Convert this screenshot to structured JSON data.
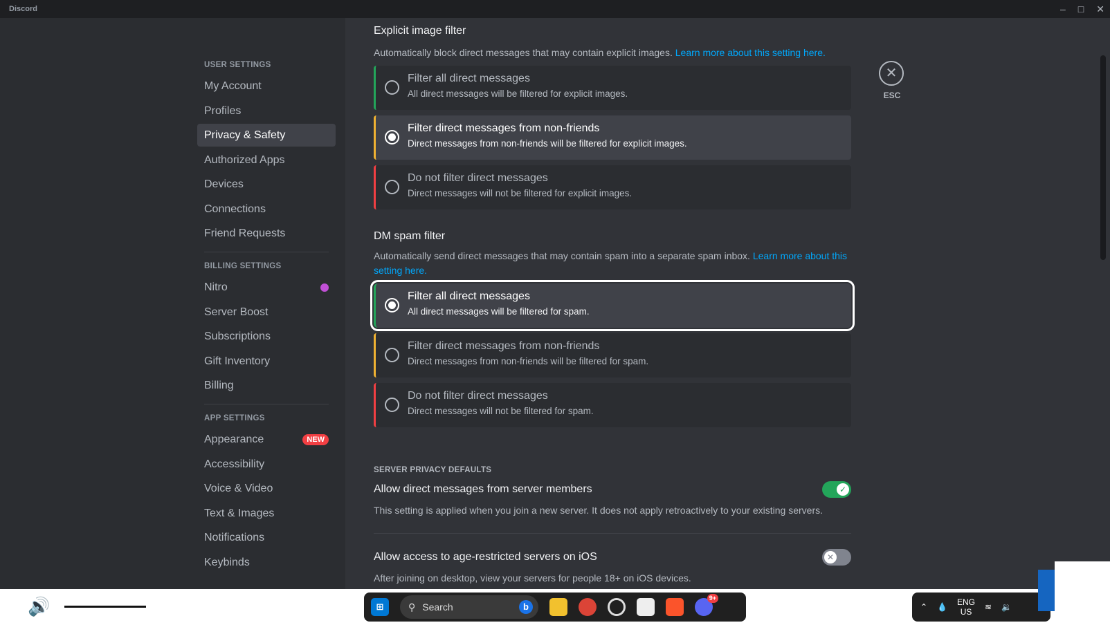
{
  "app": {
    "title": "Discord",
    "window_controls": [
      "minimize",
      "maximize",
      "close"
    ]
  },
  "sidebar": {
    "sections": [
      {
        "header": "USER SETTINGS",
        "items": [
          {
            "label": "My Account"
          },
          {
            "label": "Profiles"
          },
          {
            "label": "Privacy & Safety",
            "selected": true
          },
          {
            "label": "Authorized Apps"
          },
          {
            "label": "Devices"
          },
          {
            "label": "Connections"
          },
          {
            "label": "Friend Requests"
          }
        ]
      },
      {
        "header": "BILLING SETTINGS",
        "items": [
          {
            "label": "Nitro",
            "icon": "nitro-icon"
          },
          {
            "label": "Server Boost"
          },
          {
            "label": "Subscriptions"
          },
          {
            "label": "Gift Inventory"
          },
          {
            "label": "Billing"
          }
        ]
      },
      {
        "header": "APP SETTINGS",
        "items": [
          {
            "label": "Appearance",
            "badge": "NEW"
          },
          {
            "label": "Accessibility"
          },
          {
            "label": "Voice & Video"
          },
          {
            "label": "Text & Images"
          },
          {
            "label": "Notifications"
          },
          {
            "label": "Keybinds"
          }
        ]
      }
    ]
  },
  "explicit": {
    "title": "Explicit image filter",
    "desc": "Automatically block direct messages that may contain explicit images.",
    "link": "Learn more about this setting here.",
    "options": [
      {
        "label": "Filter all direct messages",
        "sub": "All direct messages will be filtered for explicit images.",
        "selected": false
      },
      {
        "label": "Filter direct messages from non-friends",
        "sub": "Direct messages from non-friends will be filtered for explicit images.",
        "selected": true
      },
      {
        "label": "Do not filter direct messages",
        "sub": "Direct messages will not be filtered for explicit images.",
        "selected": false
      }
    ]
  },
  "spam": {
    "title": "DM spam filter",
    "desc": "Automatically send direct messages that may contain spam into a separate spam inbox.",
    "link": "Learn more about this setting here.",
    "options": [
      {
        "label": "Filter all direct messages",
        "sub": "All direct messages will be filtered for spam.",
        "selected": true
      },
      {
        "label": "Filter direct messages from non-friends",
        "sub": "Direct messages from non-friends will be filtered for spam.",
        "selected": false
      },
      {
        "label": "Do not filter direct messages",
        "sub": "Direct messages will not be filtered for spam.",
        "selected": false
      }
    ]
  },
  "server_privacy": {
    "header": "SERVER PRIVACY DEFAULTS",
    "settings": [
      {
        "label": "Allow direct messages from server members",
        "desc": "This setting is applied when you join a new server. It does not apply retroactively to your existing servers.",
        "enabled": true
      },
      {
        "label": "Allow access to age-restricted servers on iOS",
        "desc": "After joining on desktop, view your servers for people 18+ on iOS devices.",
        "enabled": false
      }
    ]
  },
  "esc": {
    "label": "ESC"
  },
  "taskbar": {
    "search": "Search",
    "lang": "ENG",
    "region": "US",
    "discord_badge": "9+"
  },
  "colors": {
    "accent_link": "#00a8fc",
    "green": "#23a55a",
    "yellow": "#f0b232",
    "red": "#f23f43"
  }
}
